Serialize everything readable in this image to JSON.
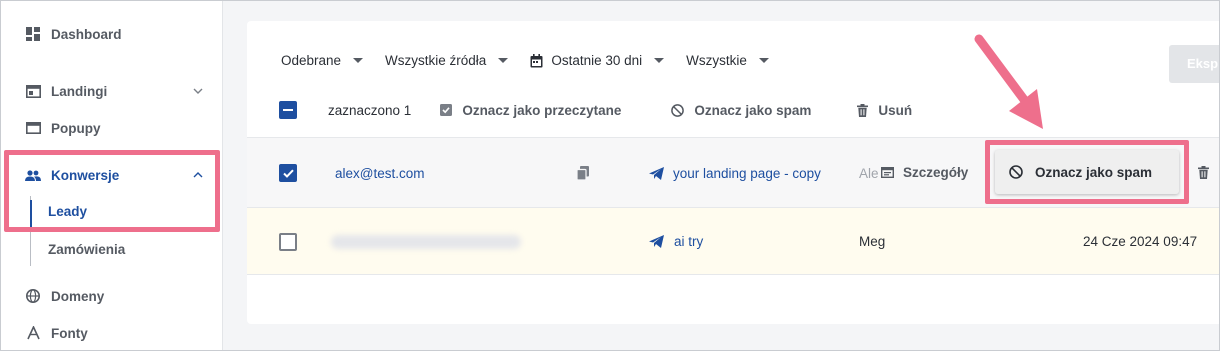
{
  "sidebar": {
    "items": [
      {
        "label": "Dashboard",
        "icon": "dashboard-icon"
      },
      {
        "label": "Landingi",
        "icon": "landing-icon"
      },
      {
        "label": "Popupy",
        "icon": "popup-icon"
      },
      {
        "label": "Konwersje",
        "icon": "people-icon"
      },
      {
        "label": "Domeny",
        "icon": "globe-icon"
      },
      {
        "label": "Fonty",
        "icon": "font-icon"
      }
    ],
    "subitems": [
      {
        "label": "Leady"
      },
      {
        "label": "Zamówienia"
      }
    ]
  },
  "filters": {
    "status": "Odebrane",
    "source": "Wszystkie źródła",
    "period": "Ostatnie 30 dni",
    "type": "Wszystkie"
  },
  "export_label": "Eksp",
  "bulk": {
    "selected": "zaznaczono 1",
    "mark_read": "Oznacz jako przeczytane",
    "mark_spam": "Oznacz jako spam",
    "delete": "Usuń"
  },
  "rows": [
    {
      "email": "alex@test.com",
      "landing": "your landing page - copy",
      "name": "Ale",
      "details": "Szczegóły",
      "action": "Oznacz jako spam",
      "checked": true
    },
    {
      "landing": "ai try",
      "name": "Meg",
      "date": "24 Cze 2024 09:47",
      "checked": false
    }
  ],
  "colors": {
    "accent": "#1e4fa0",
    "highlight": "#ee6f8c",
    "row_highlight": "#fffcef"
  }
}
